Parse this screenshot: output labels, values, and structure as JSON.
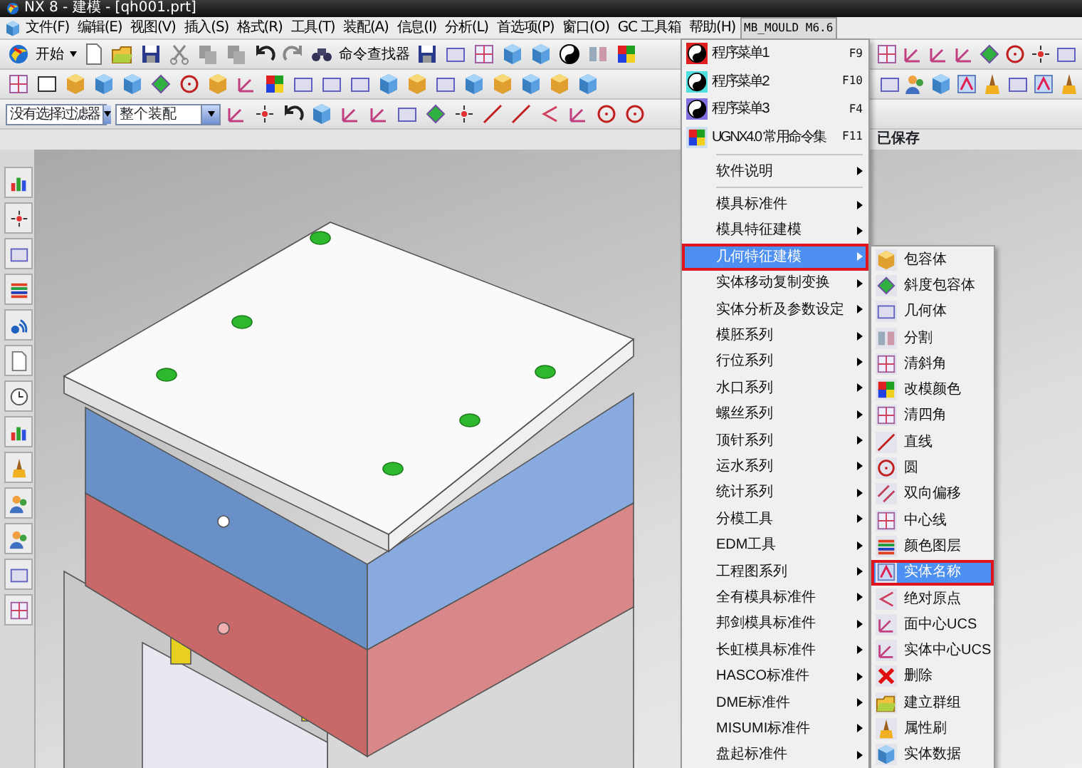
{
  "window": {
    "title": "NX 8 - 建模 - [qh001.prt]"
  },
  "menu_bar": [
    {
      "label": "文件(F)",
      "selected": false
    },
    {
      "label": "编辑(E)",
      "selected": false
    },
    {
      "label": "视图(V)",
      "selected": false
    },
    {
      "label": "插入(S)",
      "selected": false
    },
    {
      "label": "格式(R)",
      "selected": false
    },
    {
      "label": "工具(T)",
      "selected": false
    },
    {
      "label": "装配(A)",
      "selected": false
    },
    {
      "label": "信息(I)",
      "selected": false
    },
    {
      "label": "分析(L)",
      "selected": false
    },
    {
      "label": "首选项(P)",
      "selected": false
    },
    {
      "label": "窗口(O)",
      "selected": false
    },
    {
      "label": "GC 工具箱",
      "selected": false
    },
    {
      "label": "帮助(H)",
      "selected": false
    },
    {
      "label": "MB_MOULD M6.6",
      "selected": true
    }
  ],
  "toolbar": {
    "start_button": "开始",
    "command_finder": "命令查找器",
    "selection_filter": {
      "value": "没有选择过滤器"
    },
    "assembly_scope": {
      "value": "整个装配"
    }
  },
  "status_bar": {
    "message": "已保存"
  },
  "dropdown_menu": {
    "items": [
      {
        "kind": "command",
        "label": "程序菜单1",
        "shortcut": "F9"
      },
      {
        "kind": "command",
        "label": "程序菜单2",
        "shortcut": "F10"
      },
      {
        "kind": "command",
        "label": "程序菜单3",
        "shortcut": "F4"
      },
      {
        "kind": "command",
        "label": "UGNX4.0 常用命令集",
        "shortcut": "F11"
      },
      {
        "kind": "separator"
      },
      {
        "kind": "submenu",
        "label": "软件说明",
        "selected": false
      },
      {
        "kind": "separator"
      },
      {
        "kind": "submenu",
        "label": "模具标准件",
        "selected": false
      },
      {
        "kind": "submenu",
        "label": "模具特征建模",
        "selected": false
      },
      {
        "kind": "submenu",
        "label": "几何特征建模",
        "selected": true
      },
      {
        "kind": "submenu",
        "label": "实体移动复制变换",
        "selected": false
      },
      {
        "kind": "submenu",
        "label": "实体分析及参数设定",
        "selected": false
      },
      {
        "kind": "submenu",
        "label": "模胚系列",
        "selected": false
      },
      {
        "kind": "submenu",
        "label": "行位系列",
        "selected": false
      },
      {
        "kind": "submenu",
        "label": "水口系列",
        "selected": false
      },
      {
        "kind": "submenu",
        "label": "螺丝系列",
        "selected": false
      },
      {
        "kind": "submenu",
        "label": "顶针系列",
        "selected": false
      },
      {
        "kind": "submenu",
        "label": "运水系列",
        "selected": false
      },
      {
        "kind": "submenu",
        "label": "统计系列",
        "selected": false
      },
      {
        "kind": "submenu",
        "label": "分模工具",
        "selected": false
      },
      {
        "kind": "submenu",
        "label": "EDM工具",
        "selected": false
      },
      {
        "kind": "submenu",
        "label": "工程图系列",
        "selected": false
      },
      {
        "kind": "submenu",
        "label": "全有模具标准件",
        "selected": false
      },
      {
        "kind": "submenu",
        "label": "邦剑模具标准件",
        "selected": false
      },
      {
        "kind": "submenu",
        "label": "长虹模具标准件",
        "selected": false
      },
      {
        "kind": "submenu",
        "label": "HASCO标准件",
        "selected": false
      },
      {
        "kind": "submenu",
        "label": "DME标准件",
        "selected": false
      },
      {
        "kind": "submenu",
        "label": "MISUMI标准件",
        "selected": false
      },
      {
        "kind": "submenu",
        "label": "盘起标准件",
        "selected": false
      }
    ]
  },
  "submenu": {
    "items": [
      {
        "label": "包容体",
        "selected": false
      },
      {
        "label": "斜度包容体",
        "selected": false
      },
      {
        "label": "几何体",
        "selected": false
      },
      {
        "label": "分割",
        "selected": false
      },
      {
        "label": "清斜角",
        "selected": false
      },
      {
        "label": "改模颜色",
        "selected": false
      },
      {
        "label": "清四角",
        "selected": false
      },
      {
        "label": "直线",
        "selected": false
      },
      {
        "label": "圆",
        "selected": false
      },
      {
        "label": "双向偏移",
        "selected": false
      },
      {
        "label": "中心线",
        "selected": false
      },
      {
        "label": "颜色图层",
        "selected": false
      },
      {
        "label": "实体名称",
        "selected": true
      },
      {
        "label": "绝对原点",
        "selected": false
      },
      {
        "label": "面中心UCS",
        "selected": false
      },
      {
        "label": "实体中心UCS",
        "selected": false
      },
      {
        "label": "删除",
        "selected": false
      },
      {
        "label": "建立群组",
        "selected": false
      },
      {
        "label": "属性刷",
        "selected": false
      },
      {
        "label": "实体数据",
        "selected": false
      }
    ]
  }
}
